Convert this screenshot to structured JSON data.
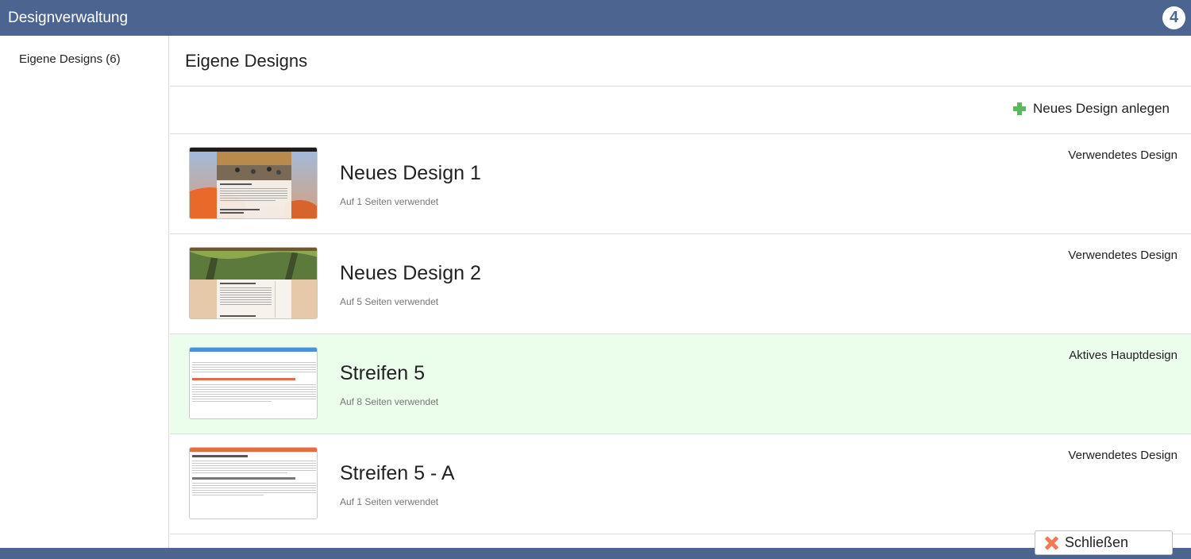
{
  "app": {
    "title": "Designverwaltung",
    "logo_text": "4",
    "logo_icon": "four-circle-icon"
  },
  "sidebar": {
    "items": [
      {
        "label": "Eigene Designs (6)"
      }
    ]
  },
  "main": {
    "title": "Eigene Designs",
    "new_design_label": "Neues Design anlegen",
    "new_design_icon": "plus-icon",
    "designs": [
      {
        "name": "Neues Design 1",
        "usage": "Auf 1 Seiten verwendet",
        "status": "Verwendetes Design",
        "active": false,
        "thumbnail": "desert-people-thumbnail"
      },
      {
        "name": "Neues Design 2",
        "usage": "Auf 5 Seiten verwendet",
        "status": "Verwendetes Design",
        "active": false,
        "thumbnail": "forest-thumbnail"
      },
      {
        "name": "Streifen 5",
        "usage": "Auf 8 Seiten verwendet",
        "status": "Aktives Hauptdesign",
        "active": true,
        "thumbnail": "blue-stripe-thumbnail"
      },
      {
        "name": "Streifen 5 - A",
        "usage": "Auf 1 Seiten verwendet",
        "status": "Verwendetes Design",
        "active": false,
        "thumbnail": "orange-stripe-thumbnail"
      }
    ]
  },
  "footer": {
    "close_label": "Schließen",
    "close_icon": "close-x-icon"
  },
  "colors": {
    "titlebar": "#4b6590",
    "active_row": "#ebfdeb",
    "plus": "#5cb85c",
    "close_x": "#f07a55"
  }
}
